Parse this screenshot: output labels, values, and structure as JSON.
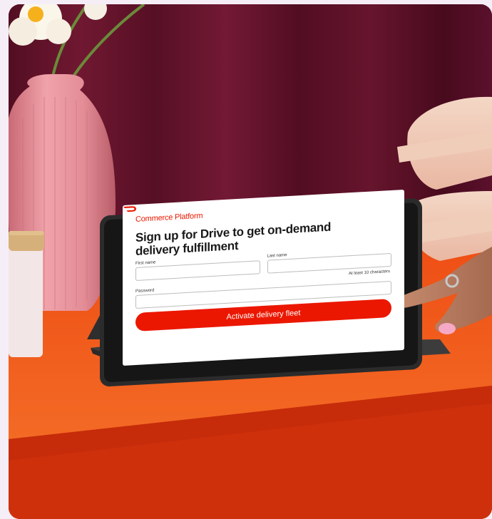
{
  "photo": {
    "subject": "tablet-on-stand-with-signup-form",
    "colors": {
      "curtain": "#6b1530",
      "table": "#f0561b",
      "vase": "#e8909a",
      "accent": "#eb1700"
    }
  },
  "signup_screen": {
    "brand_icon": "doordash-logo-icon",
    "brand_name": "Commerce Platform",
    "headline": "Sign up for Drive to get on-demand delivery fulfillment",
    "first_name_label": "First name",
    "last_name_label": "Last name",
    "password_hint": "At least 10 characters",
    "password_label": "Password",
    "submit_label": "Activate delivery fleet"
  }
}
